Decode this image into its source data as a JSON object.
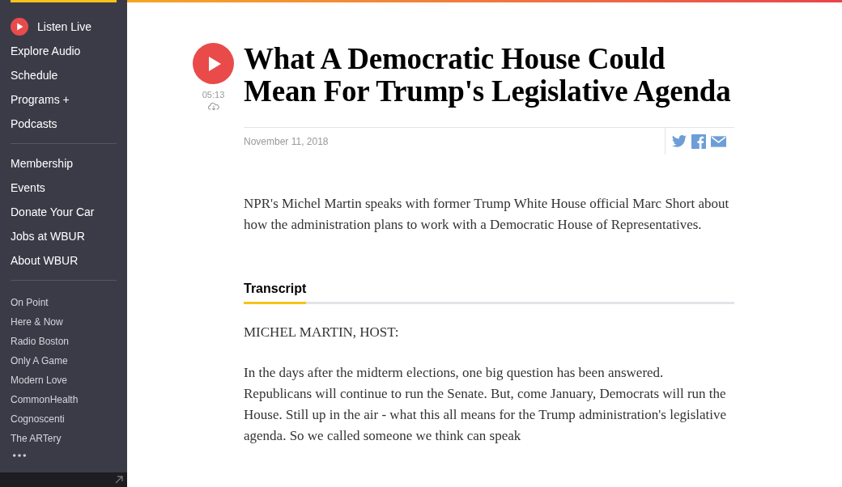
{
  "sidebar": {
    "listen_live": "Listen Live",
    "primary": [
      "Explore Audio",
      "Schedule",
      "Programs + Podcasts"
    ],
    "secondary": [
      "Membership",
      "Events",
      "Donate Your Car",
      "Jobs at WBUR",
      "About WBUR"
    ],
    "programs": [
      "On Point",
      "Here & Now",
      "Radio Boston",
      "Only A Game",
      "Modern Love",
      "CommonHealth",
      "Cognoscenti",
      "The ARTery"
    ]
  },
  "article": {
    "duration": "05:13",
    "title": "What A Democratic House Could Mean For Trump's Legislative Agenda",
    "date": "November 11, 2018",
    "summary": "NPR's Michel Martin speaks with former Trump White House official Marc Short about how the administration plans to work with a Democratic House of Representatives.",
    "transcript_tab": {
      "label": "Transcript",
      "selected": true
    },
    "transcript": [
      "MICHEL MARTIN, HOST:",
      "In the days after the midterm elections, one big question has been answered. Republicans will continue to run the Senate. But, come January, Democrats will run the House. Still up in the air - what this all means for the Trump administration's legislative agenda. So we called someone we think can speak"
    ]
  }
}
